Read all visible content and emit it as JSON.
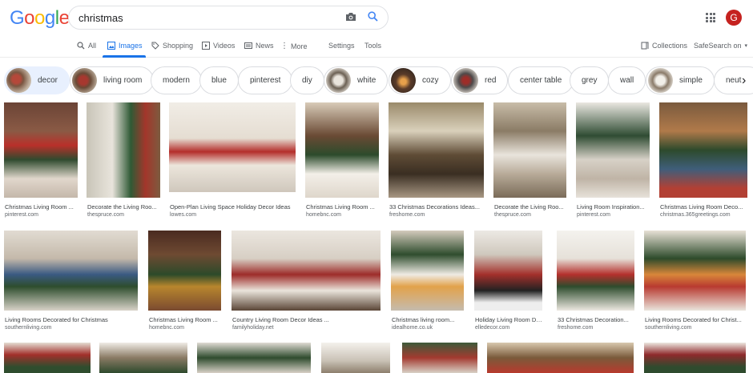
{
  "logo": {
    "letters": [
      "G",
      "o",
      "o",
      "g",
      "l",
      "e"
    ],
    "colors": [
      "#4285f4",
      "#ea4335",
      "#fbbc05",
      "#4285f4",
      "#34a853",
      "#ea4335"
    ]
  },
  "search": {
    "value": "christmas",
    "camera_icon": "camera-icon",
    "search_icon": "search-icon"
  },
  "account": {
    "initial": "G",
    "color": "#c5221f"
  },
  "tabs": [
    {
      "label": "All",
      "icon": "search-icon"
    },
    {
      "label": "Images",
      "icon": "image-icon",
      "active": true
    },
    {
      "label": "Shopping",
      "icon": "tag-icon"
    },
    {
      "label": "Videos",
      "icon": "play-icon"
    },
    {
      "label": "News",
      "icon": "news-icon"
    },
    {
      "label": "More",
      "icon": "more-icon"
    },
    {
      "label": "Settings"
    },
    {
      "label": "Tools"
    }
  ],
  "right_tabs": {
    "collections": "Collections",
    "safesearch": "SafeSearch on"
  },
  "chips": [
    {
      "label": "decor",
      "selected": true,
      "thumb": true
    },
    {
      "label": "living room",
      "thumb": true
    },
    {
      "label": "modern"
    },
    {
      "label": "blue"
    },
    {
      "label": "pinterest"
    },
    {
      "label": "diy"
    },
    {
      "label": "white",
      "thumb": true
    },
    {
      "label": "cozy",
      "thumb": true
    },
    {
      "label": "red",
      "thumb": true
    },
    {
      "label": "center table"
    },
    {
      "label": "grey"
    },
    {
      "label": "wall"
    },
    {
      "label": "simple",
      "thumb": true
    },
    {
      "label": "neutral"
    }
  ],
  "results_row1": [
    {
      "title": "Christmas Living Room ...",
      "source": "pinterest.com"
    },
    {
      "title": "Decorate the Living Roo...",
      "source": "thespruce.com"
    },
    {
      "title": "Open-Plan Living Space Holiday Decor Ideas",
      "source": "lowes.com"
    },
    {
      "title": "Christmas Living Room ...",
      "source": "homebnc.com"
    },
    {
      "title": "33 Christmas Decorations Ideas...",
      "source": "freshome.com"
    },
    {
      "title": "Decorate the Living Roo...",
      "source": "thespruce.com"
    },
    {
      "title": "Living Room Inspiration...",
      "source": "pinterest.com"
    },
    {
      "title": "Christmas Living Room Deco...",
      "source": "christmas.365greetings.com"
    }
  ],
  "results_row2": [
    {
      "title": "Living Rooms Decorated for Christmas",
      "source": "southernliving.com"
    },
    {
      "title": "Christmas Living Room ...",
      "source": "homebnc.com"
    },
    {
      "title": "Country Living Room Decor Ideas ...",
      "source": "familyholiday.net"
    },
    {
      "title": "Christmas living room...",
      "source": "idealhome.co.uk"
    },
    {
      "title": "Holiday Living Room De...",
      "source": "elledecor.com"
    },
    {
      "title": "33 Christmas Decoration...",
      "source": "freshome.com"
    },
    {
      "title": "Living Rooms Decorated for Christ...",
      "source": "southernliving.com"
    }
  ]
}
